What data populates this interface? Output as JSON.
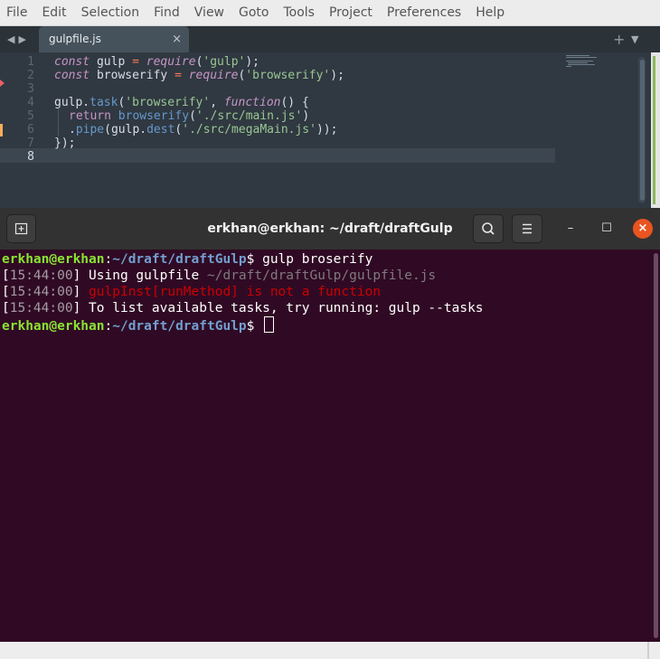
{
  "menu": [
    "File",
    "Edit",
    "Selection",
    "Find",
    "View",
    "Goto",
    "Tools",
    "Project",
    "Preferences",
    "Help"
  ],
  "editor": {
    "tab": {
      "title": "gulpfile.js",
      "close": "×"
    },
    "nav": {
      "back": "◀",
      "forward": "▶"
    },
    "tab_add": "+",
    "tab_menu": "▼",
    "line_numbers": [
      "1",
      "2",
      "3",
      "4",
      "5",
      "6",
      "7",
      "8"
    ],
    "active_line": "8",
    "code": {
      "l1": {
        "kw": "const",
        "a": " gulp ",
        "eq": "=",
        "sp": " ",
        "req": "require",
        "p1": "(",
        "s": "'gulp'",
        "p2": ");"
      },
      "l2": {
        "kw": "const",
        "a": " browserify ",
        "eq": "=",
        "sp": " ",
        "req": "require",
        "p1": "(",
        "s": "'browserify'",
        "p2": ");"
      },
      "l4": {
        "a": "gulp.",
        "fn": "task",
        "p1": "(",
        "s": "'browserify'",
        "c": ", ",
        "kw": "function",
        "p2": "() {"
      },
      "l5": {
        "kw": "return",
        "sp": " ",
        "fn": "browserify",
        "p1": "(",
        "s": "'./src/main.js'",
        "p2": ")"
      },
      "l6": {
        "dot": ".",
        "fn": "pipe",
        "p1": "(gulp.",
        "fn2": "dest",
        "p2": "(",
        "s": "'./src/megaMain.js'",
        "p3": "));"
      },
      "l7": {
        "a": "});"
      }
    }
  },
  "terminal": {
    "title": "erkhan@erkhan: ~/draft/draftGulp",
    "prompt_user": "erkhan@erkhan",
    "prompt_colon": ":",
    "prompt_path": "~/draft/draftGulp",
    "prompt_dollar": "$ ",
    "command": "gulp broserify",
    "lines": [
      {
        "ob": "[",
        "time": "15:44:00",
        "cb": "] ",
        "text": "Using gulpfile ",
        "dim": "~/draft/draftGulp/gulpfile.js"
      },
      {
        "ob": "[",
        "time": "15:44:00",
        "cb": "] ",
        "err": "gulpInst[runMethod] is not a function"
      },
      {
        "ob": "[",
        "time": "15:44:00",
        "cb": "] ",
        "text": "To list available tasks, try running: gulp --tasks"
      }
    ],
    "controls": {
      "minimize": "–",
      "maximize": "☐",
      "close": "×"
    }
  }
}
